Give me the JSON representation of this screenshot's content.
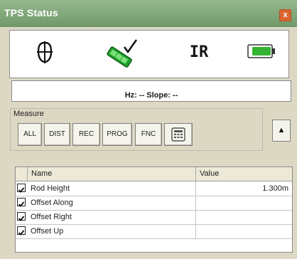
{
  "window": {
    "title": "TPS Status",
    "close_label": "x"
  },
  "status_icons": [
    {
      "name": "crosshair-prism-icon"
    },
    {
      "name": "reflector-target-icon"
    },
    {
      "name": "ir-mode",
      "label": "IR"
    },
    {
      "name": "battery-icon",
      "level": 0.85
    }
  ],
  "angles": {
    "text": "Hz: -- Slope: --"
  },
  "measure": {
    "label": "Measure",
    "buttons": [
      "ALL",
      "DIST",
      "REC",
      "PROG",
      "FNC"
    ],
    "extra_button_icon": "keypad-icon",
    "scroll_up": "▲"
  },
  "table": {
    "columns": [
      "Name",
      "Value"
    ],
    "rows": [
      {
        "name": "Rod Height",
        "value": "1.300m",
        "checked": true
      },
      {
        "name": "Offset Along",
        "value": "",
        "checked": true
      },
      {
        "name": "Offset Right",
        "value": "",
        "checked": true
      },
      {
        "name": "Offset Up",
        "value": "",
        "checked": true
      }
    ]
  }
}
